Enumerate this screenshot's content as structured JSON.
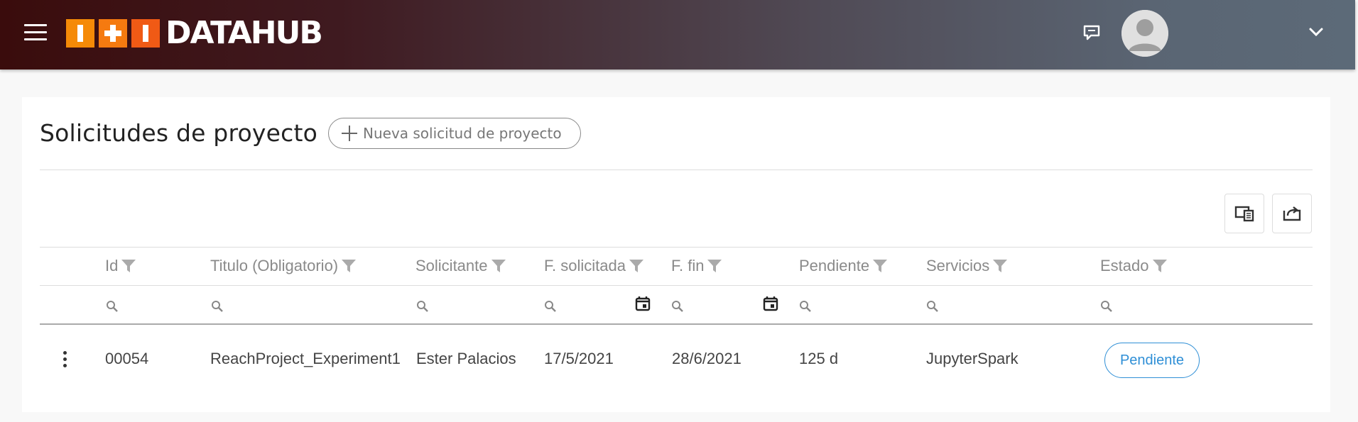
{
  "header": {
    "logo_text": "DATAHUB",
    "brand_colors": [
      "#f58a07",
      "#f57a10",
      "#f05a15"
    ],
    "icons": [
      "menu-icon",
      "chat-icon",
      "avatar-icon",
      "chevron-down-icon"
    ]
  },
  "page": {
    "title": "Solicitudes de proyecto",
    "new_button_label": "Nueva solicitud de proyecto"
  },
  "toolbar": {
    "buttons": [
      "columns-icon",
      "export-icon"
    ]
  },
  "table": {
    "columns": [
      {
        "key": "id",
        "label": "Id"
      },
      {
        "key": "titulo",
        "label": "Titulo (Obligatorio)"
      },
      {
        "key": "solicitante",
        "label": "Solicitante"
      },
      {
        "key": "f_solicitada",
        "label": "F. solicitada"
      },
      {
        "key": "f_fin",
        "label": "F. fin"
      },
      {
        "key": "pendiente",
        "label": "Pendiente"
      },
      {
        "key": "servicios",
        "label": "Servicios"
      },
      {
        "key": "estado",
        "label": "Estado"
      }
    ],
    "rows": [
      {
        "id": "00054",
        "titulo": "ReachProject_Experiment1",
        "solicitante": "Ester Palacios",
        "f_solicitada": "17/5/2021",
        "f_fin": "28/6/2021",
        "pendiente": "125 d",
        "servicios": "JupyterSpark",
        "estado": "Pendiente"
      }
    ]
  },
  "colors": {
    "accent": "#2f8fd6",
    "header_gradient_start": "#3a0c0c",
    "header_gradient_end": "#5c6a78"
  }
}
